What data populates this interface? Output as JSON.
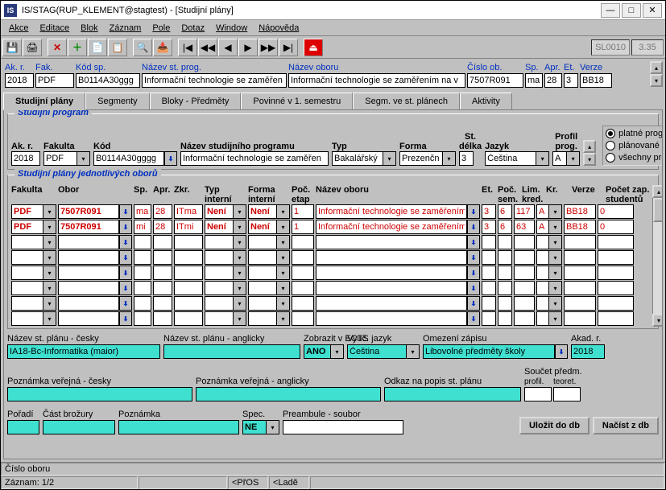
{
  "window": {
    "title": "IS/STAG(RUP_KLEMENT@stagtest) - [Studijní plány]"
  },
  "menus": [
    "Akce",
    "Editace",
    "Blok",
    "Záznam",
    "Pole",
    "Dotaz",
    "Window",
    "Nápověda"
  ],
  "toolbar_status": {
    "code": "SL0010",
    "version": "3.35"
  },
  "header": {
    "ak_r_label": "Ak. r.",
    "fak_label": "Fak.",
    "kod_sp_label": "Kód sp.",
    "nazev_sp_label": "Název st. prog.",
    "nazev_oboru_label": "Název oboru",
    "cislo_ob_label": "Číslo ob.",
    "sp_label": "Sp.",
    "apr_label": "Apr.",
    "et_label": "Et.",
    "verze_label": "Verze",
    "ak_r": "2018",
    "fak": "PDF",
    "kod_sp": "B0114A30ggg",
    "nazev_sp": "Informační technologie se zaměřen",
    "nazev_oboru": "Informační technologie se zaměřením na v",
    "cislo_ob": "7507R091",
    "sp": "ma",
    "apr": "28",
    "et": "3",
    "verze": "BB18"
  },
  "tabs": [
    "Studijní plány",
    "Segmenty",
    "Bloky - Předměty",
    "Povinné v 1. semestru",
    "Segm. ve st. plánech",
    "Aktivity"
  ],
  "program_box": {
    "title": "Studijní program",
    "labels": {
      "ak_r": "Ak. r.",
      "fakulta": "Fakulta",
      "kod": "Kód",
      "nazev": "Název studijního  programu",
      "typ": "Typ",
      "forma": "Forma",
      "st_delka": "St. délka",
      "jazyk": "Jazyk",
      "profil": "Profil prog."
    },
    "values": {
      "ak_r": "2018",
      "fakulta": "PDF",
      "kod": "B0114A30gggg",
      "nazev": "Informační technologie se zaměřen",
      "typ": "Bakalářský",
      "forma": "Prezenčn",
      "st_delka": "3",
      "jazyk": "Čeština",
      "profil": "A"
    },
    "radios": [
      "platné programy",
      "plánované prog.",
      "všechny programy"
    ],
    "radio_selected": 0
  },
  "plans_box": {
    "title": "Studijní plány jednotlivých oborů",
    "headers": {
      "fakulta": "Fakulta",
      "obor": "Obor",
      "sp": "Sp.",
      "apr": "Apr.",
      "zkr": "Zkr.",
      "typ_interni": "Typ interní",
      "forma_interni": "Forma interní",
      "poc_etap": "Poč. etap",
      "nazev_oboru": "Název oboru",
      "et": "Et.",
      "poc_sem": "Poč. sem.",
      "lim_kred": "Lim. kred.",
      "kr": "Kr.",
      "verze": "Verze",
      "pocet_zap": "Počet zap. studentů"
    },
    "rows": [
      {
        "fakulta": "PDF",
        "obor": "7507R091",
        "sp": "ma",
        "apr": "28",
        "zkr": "ITma",
        "typ_interni": "Není",
        "forma_interni": "Není",
        "poc_etap": "1",
        "nazev_oboru": "Informační technologie se zaměřením",
        "et": "3",
        "poc_sem": "6",
        "lim_kred": "117",
        "kr": "A",
        "verze": "BB18",
        "pocet_zap": "0"
      },
      {
        "fakulta": "PDF",
        "obor": "7507R091",
        "sp": "mi",
        "apr": "28",
        "zkr": "ITmi",
        "typ_interni": "Není",
        "forma_interni": "Není",
        "poc_etap": "1",
        "nazev_oboru": "Informační technologie se zaměřením",
        "et": "3",
        "poc_sem": "6",
        "lim_kred": "63",
        "kr": "A",
        "verze": "BB18",
        "pocet_zap": "0"
      }
    ]
  },
  "detail": {
    "labels": {
      "nazev_cz": "Název st. plánu - česky",
      "nazev_en": "Název st. plánu - anglicky",
      "zobrazit": "Zobrazit v ECTS",
      "vyuc_jazyk": "Vyuč. jazyk",
      "omezeni": "Omezení zápisu",
      "akad_r": "Akad. r.",
      "pozn_cz": "Poznámka veřejná - česky",
      "pozn_en": "Poznámka veřejná - anglicky",
      "odkaz": "Odkaz na popis st. plánu",
      "soucet": "Součet předm.",
      "profil": "profil.",
      "teoret": "teoret.",
      "poradi": "Pořadí",
      "brozura": "Část brožury",
      "poznamka": "Poznámka",
      "spec": "Spec.",
      "preambule": "Preambule - soubor"
    },
    "values": {
      "nazev_cz": "IA18-Bc-Informatika (maior)",
      "nazev_en": "",
      "zobrazit": "ANO",
      "vyuc_jazyk": "Čeština",
      "omezeni": "Libovolné předměty školy",
      "akad_r": "2018",
      "pozn_cz": "",
      "pozn_en": "",
      "odkaz": "",
      "profil": "",
      "teoret": "",
      "poradi": "",
      "brozura": "",
      "poznamka": "",
      "spec": "NE",
      "preambule": ""
    },
    "buttons": {
      "save": "Uložit do db",
      "load": "Načíst z db"
    }
  },
  "status": {
    "top": "Číslo oboru",
    "record_lbl": "Záznam: 1/2",
    "mod1": "<PřOS",
    "mod2": "<Ladě"
  }
}
